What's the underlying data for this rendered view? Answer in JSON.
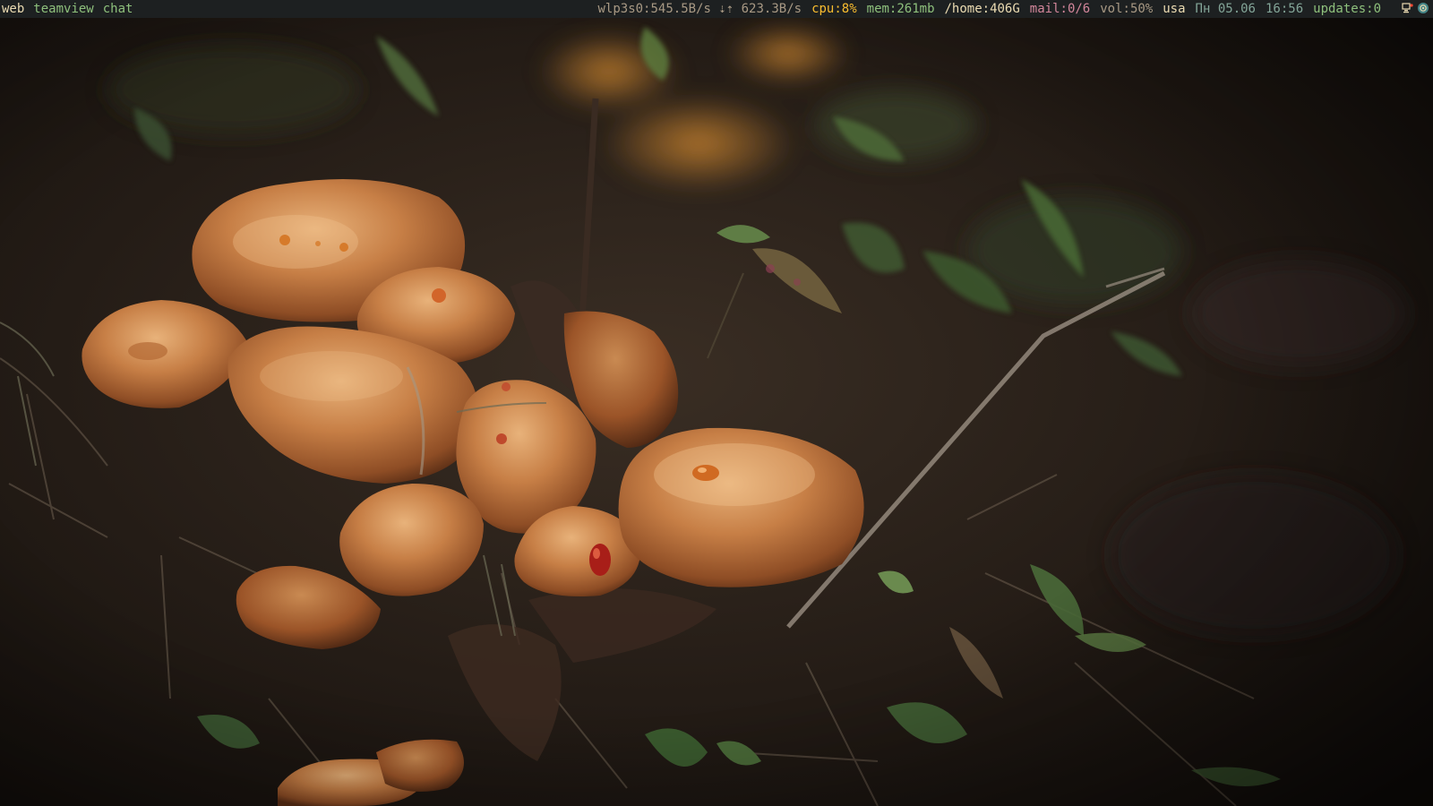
{
  "colors": {
    "bar_background": "#1d2021",
    "text_default": "#a89984",
    "text_bright": "#ebdbb2",
    "accent_green": "#8ec07c",
    "accent_yellow": "#fabd2f",
    "accent_magenta": "#d3869b",
    "accent_blue": "#83a598"
  },
  "workspaces": [
    {
      "label": "web",
      "active": true
    },
    {
      "label": "teamview",
      "active": false
    },
    {
      "label": "chat",
      "active": false
    }
  ],
  "status": {
    "network": "wlp3s0:545.5B/s ⇣⇡ 623.3B/s",
    "cpu": "cpu:8%",
    "mem": "mem:261mb",
    "disk": "/home:406G",
    "mail": "mail:0/6",
    "volume": "vol:50%",
    "layout": "usa",
    "date": "Пн 05.06",
    "time": "16:56",
    "updates": "updates:0"
  },
  "tray": {
    "icons": [
      "network-manager-icon",
      "chat-app-icon"
    ]
  },
  "wallpaper": {
    "subject": "mushrooms-on-forest-floor"
  }
}
